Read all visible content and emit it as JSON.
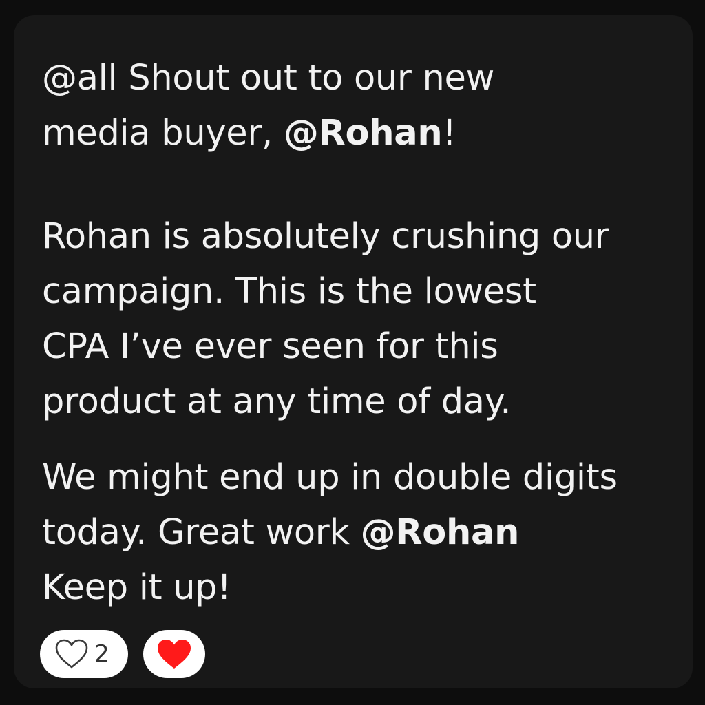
{
  "message": {
    "p1": {
      "line1": "@all Shout out to our new",
      "line2_text": "media buyer, ",
      "line2_mention": "@Rohan",
      "line2_suffix": "!"
    },
    "p2": {
      "line1": "Rohan is absolutely crushing our",
      "line2": "campaign. This is the lowest",
      "line3": "CPA I’ve ever seen for this",
      "line4": "product at any time of day."
    },
    "p3": {
      "line1": "We might end up in double digits",
      "line2_text": "today. Great work ",
      "line2_mention": "@Rohan",
      "line3": "Keep it up!"
    }
  },
  "reactions": [
    {
      "icon": "heart-outline-icon",
      "count": "2"
    },
    {
      "icon": "red-heart-icon",
      "color": "#ff1a1a"
    }
  ]
}
